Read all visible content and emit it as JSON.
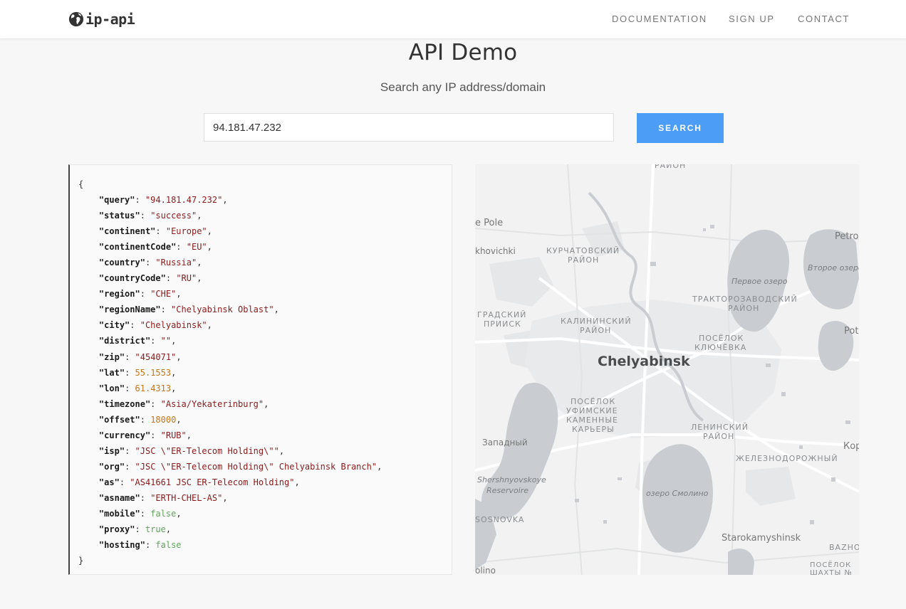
{
  "brand": {
    "name": "ip-api",
    "logo_icon": "globe-icon"
  },
  "nav": {
    "items": [
      "DOCUMENTATION",
      "SIGN UP",
      "CONTACT"
    ]
  },
  "hero": {
    "title": "API Demo",
    "subtitle": "Search any IP address/domain"
  },
  "search": {
    "value": "94.181.47.232",
    "button_label": "SEARCH"
  },
  "result": {
    "open_brace": "{",
    "close_brace": "}",
    "fields": [
      {
        "key": "query",
        "value": "\"94.181.47.232\"",
        "type": "string"
      },
      {
        "key": "status",
        "value": "\"success\"",
        "type": "string"
      },
      {
        "key": "continent",
        "value": "\"Europe\"",
        "type": "string"
      },
      {
        "key": "continentCode",
        "value": "\"EU\"",
        "type": "string"
      },
      {
        "key": "country",
        "value": "\"Russia\"",
        "type": "string"
      },
      {
        "key": "countryCode",
        "value": "\"RU\"",
        "type": "string"
      },
      {
        "key": "region",
        "value": "\"CHE\"",
        "type": "string"
      },
      {
        "key": "regionName",
        "value": "\"Chelyabinsk Oblast\"",
        "type": "string"
      },
      {
        "key": "city",
        "value": "\"Chelyabinsk\"",
        "type": "string"
      },
      {
        "key": "district",
        "value": "\"\"",
        "type": "string"
      },
      {
        "key": "zip",
        "value": "\"454071\"",
        "type": "string"
      },
      {
        "key": "lat",
        "value": "55.1553",
        "type": "number"
      },
      {
        "key": "lon",
        "value": "61.4313",
        "type": "number"
      },
      {
        "key": "timezone",
        "value": "\"Asia/Yekaterinburg\"",
        "type": "string"
      },
      {
        "key": "offset",
        "value": "18000",
        "type": "number"
      },
      {
        "key": "currency",
        "value": "\"RUB\"",
        "type": "string"
      },
      {
        "key": "isp",
        "value": "\"JSC \\\"ER-Telecom Holding\\\"\"",
        "type": "string"
      },
      {
        "key": "org",
        "value": "\"JSC \\\"ER-Telecom Holding\\\" Chelyabinsk Branch\"",
        "type": "string"
      },
      {
        "key": "as",
        "value": "\"AS41661 JSC ER-Telecom Holding\"",
        "type": "string"
      },
      {
        "key": "asname",
        "value": "\"ERTH-CHEL-AS\"",
        "type": "string"
      },
      {
        "key": "mobile",
        "value": "false",
        "type": "bool"
      },
      {
        "key": "proxy",
        "value": "true",
        "type": "bool"
      },
      {
        "key": "hosting",
        "value": "false",
        "type": "bool"
      }
    ]
  },
  "map": {
    "city_label": "Chelyabinsk",
    "labels": [
      {
        "text": "РАЙОН",
        "style": "caps"
      },
      {
        "text": "e Pole",
        "style": "place"
      },
      {
        "text": "khovichki",
        "style": "place"
      },
      {
        "text": "КУРЧАТОВСКИЙ",
        "style": "caps"
      },
      {
        "text": "РАЙОН",
        "style": "caps"
      },
      {
        "text": "Petro",
        "style": "place"
      },
      {
        "text": "Первое озеро",
        "style": "water"
      },
      {
        "text": "Второе озеро",
        "style": "water"
      },
      {
        "text": "ТРАКТОРОЗАВОДСКИЙ",
        "style": "caps"
      },
      {
        "text": "РАЙОН",
        "style": "caps"
      },
      {
        "text": "ГРАДСКИЙ",
        "style": "caps"
      },
      {
        "text": "ПРИИСК",
        "style": "caps"
      },
      {
        "text": "КАЛИНИНСКИЙ",
        "style": "caps"
      },
      {
        "text": "РАЙОН",
        "style": "caps"
      },
      {
        "text": "ПОСЁЛОК",
        "style": "caps"
      },
      {
        "text": "КЛЮЧЁВКА",
        "style": "caps"
      },
      {
        "text": "Pot",
        "style": "place"
      },
      {
        "text": "ПОСЁЛОК",
        "style": "caps"
      },
      {
        "text": "УФИМСКИЕ",
        "style": "caps"
      },
      {
        "text": "КАМЕННЫЕ",
        "style": "caps"
      },
      {
        "text": "КАРЬЕРЫ",
        "style": "caps"
      },
      {
        "text": "ЛЕНИНСКИЙ",
        "style": "caps"
      },
      {
        "text": "РАЙОН",
        "style": "caps"
      },
      {
        "text": "Западный",
        "style": "place"
      },
      {
        "text": "Кор",
        "style": "place"
      },
      {
        "text": "ЖЕЛЕЗНОДОРОЖНЫЙ",
        "style": "caps"
      },
      {
        "text": "Shershnyovskoye",
        "style": "water"
      },
      {
        "text": "Reservoire",
        "style": "water"
      },
      {
        "text": "озеро Смолино",
        "style": "water"
      },
      {
        "text": "SOSNOVKA",
        "style": "caps"
      },
      {
        "text": "Starokamyshinsk",
        "style": "place"
      },
      {
        "text": "BAZHO",
        "style": "caps"
      },
      {
        "text": "olino",
        "style": "place"
      },
      {
        "text": "ПОСЁЛОК",
        "style": "caps"
      },
      {
        "text": "ШАХТЫ №",
        "style": "caps"
      }
    ]
  },
  "colors": {
    "accent": "#4b9df6",
    "json_string": "#8b1a1a",
    "json_number": "#c87519",
    "json_bool": "#5fa55a",
    "map_water": "#c9cdd1",
    "map_land": "#f2f2f2"
  }
}
